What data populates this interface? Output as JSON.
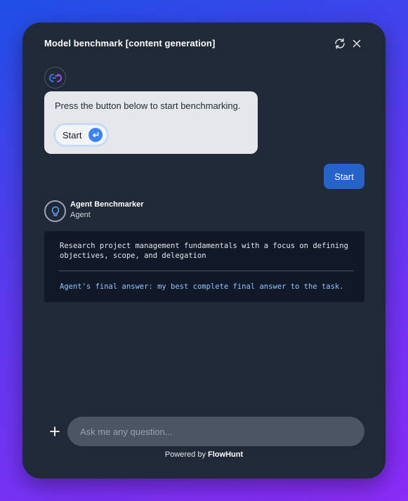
{
  "header": {
    "title": "Model benchmark [content generation]"
  },
  "bot_message": {
    "text": "Press the button below to start benchmarking.",
    "start_button_label": "Start"
  },
  "user_message": {
    "text": "Start"
  },
  "agent": {
    "name": "Agent Benchmarker",
    "role": "Agent",
    "task": "Research project management fundamentals with a focus on defining objectives, scope, and delegation",
    "final_answer": "Agent's final answer: my best complete final answer to the task."
  },
  "composer": {
    "placeholder": "Ask me any question..."
  },
  "footer": {
    "powered_prefix": "Powered by",
    "brand": "FlowHunt"
  },
  "icons": {
    "refresh": "refresh-icon",
    "close": "close-icon",
    "bot": "flowhunt-logo-icon",
    "agent": "lightbulb-icon",
    "enter": "enter-arrow-icon",
    "plus": "plus-icon"
  },
  "colors": {
    "window_bg": "#1f2937",
    "user_bubble": "#2563c9",
    "accent": "#3b82f6",
    "final_answer": "#93c5fd"
  }
}
